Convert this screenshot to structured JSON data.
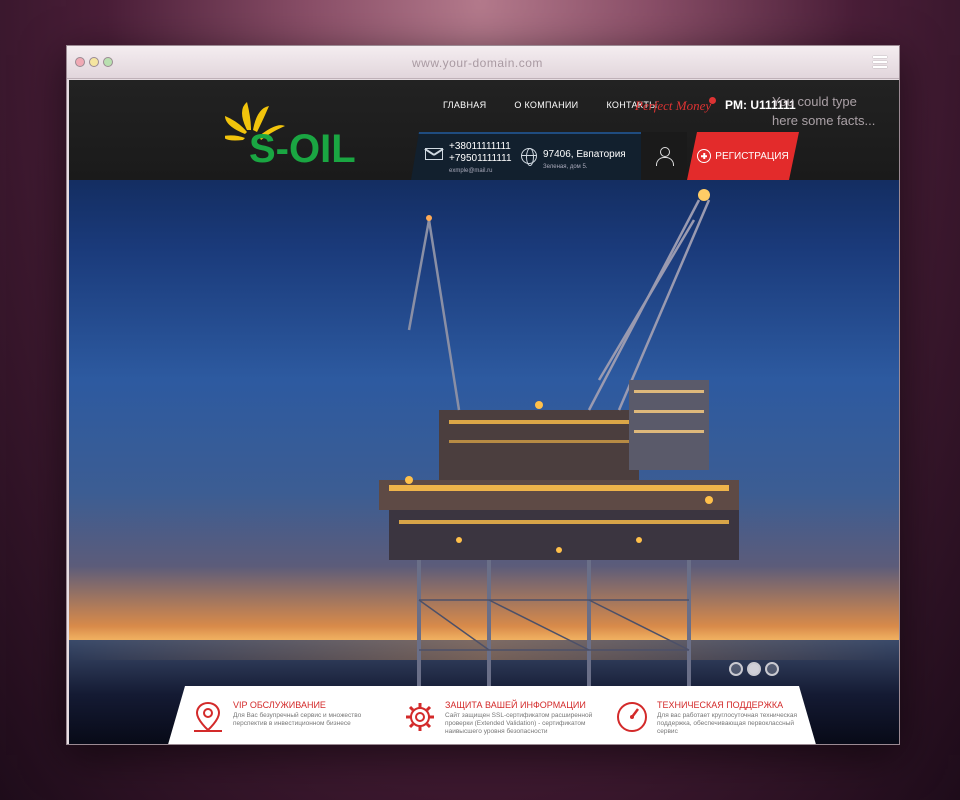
{
  "browser": {
    "url": "www.your-domain.com"
  },
  "nav": {
    "items": [
      "ГЛАВНАЯ",
      "О КОМПАНИИ",
      "КОНТАКТЫ"
    ]
  },
  "brand": {
    "logo_text": "S-OIL"
  },
  "payment": {
    "logo_text": "Perfect Money",
    "account": "PM: U111111"
  },
  "overlay": {
    "line1": "You could type",
    "line2": "here some facts..."
  },
  "contacts": {
    "phone1": "+38011111111",
    "phone2": "+79501111111",
    "email": "exmple@mail.ru",
    "address_main": "97406, Евпатория",
    "address_sub": "Зеленая, дом 5."
  },
  "register": {
    "label": "РЕГИСТРАЦИЯ"
  },
  "features": [
    {
      "title": "VIP ОБСЛУЖИВАНИЕ",
      "text": "Для Вас безупречный сервис и множество перспектив в инвестиционном бизнесе",
      "icon": "location-pin-icon"
    },
    {
      "title": "ЗАЩИТА ВАШЕЙ ИНФОРМАЦИИ",
      "text": "Сайт защищен SSL-сертификатом расширенной проверки (Extended Validation) - сертификатом наивысшего уровня безопасности",
      "icon": "gear-icon"
    },
    {
      "title": "ТЕХНИЧЕСКАЯ ПОДДЕРЖКА",
      "text": "Для вас работает круглосуточная техническая поддержка, обеспечивающая первоклассный сервис",
      "icon": "gauge-icon"
    }
  ],
  "colors": {
    "accent_red": "#e32b2b",
    "brand_green": "#1aa642",
    "brand_yellow": "#f2c40c",
    "header_bg": "#1f1f21"
  }
}
